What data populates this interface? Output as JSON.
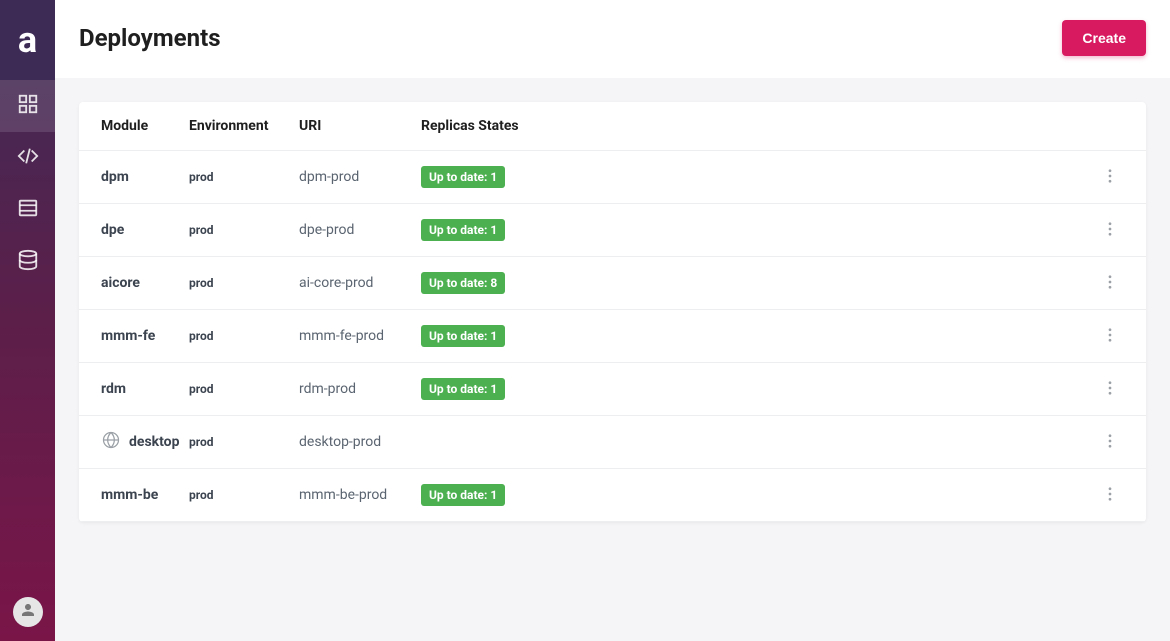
{
  "header": {
    "title": "Deployments",
    "create_label": "Create"
  },
  "table": {
    "columns": {
      "module": "Module",
      "environment": "Environment",
      "uri": "URI",
      "replicas": "Replicas States"
    },
    "rows": [
      {
        "module": "dpm",
        "env": "prod",
        "uri": "dpm-prod",
        "badge": "Up to date: 1",
        "icon": ""
      },
      {
        "module": "dpe",
        "env": "prod",
        "uri": "dpe-prod",
        "badge": "Up to date: 1",
        "icon": ""
      },
      {
        "module": "aicore",
        "env": "prod",
        "uri": "ai-core-prod",
        "badge": "Up to date: 8",
        "icon": ""
      },
      {
        "module": "mmm-fe",
        "env": "prod",
        "uri": "mmm-fe-prod",
        "badge": "Up to date: 1",
        "icon": ""
      },
      {
        "module": "rdm",
        "env": "prod",
        "uri": "rdm-prod",
        "badge": "Up to date: 1",
        "icon": ""
      },
      {
        "module": "desktop",
        "env": "prod",
        "uri": "desktop-prod",
        "badge": "",
        "icon": "globe"
      },
      {
        "module": "mmm-be",
        "env": "prod",
        "uri": "mmm-be-prod",
        "badge": "Up to date: 1",
        "icon": ""
      }
    ]
  }
}
